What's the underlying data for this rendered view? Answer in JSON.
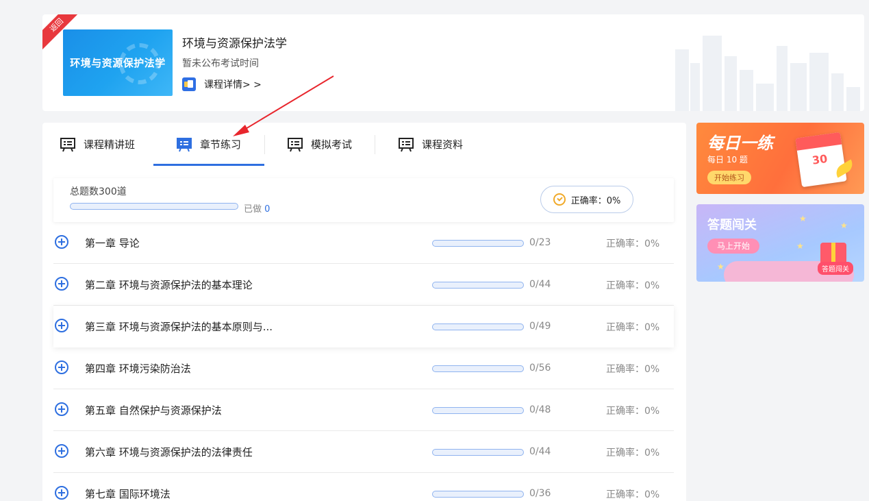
{
  "course": {
    "return_label": "返回",
    "cover_text": "环境与资源保护法学",
    "title": "环境与资源保护法学",
    "exam_time": "暂未公布考试时间",
    "detail_link": "课程详情> >"
  },
  "tabs": [
    {
      "label": "课程精讲班",
      "icon": "presentation-icon",
      "active": false
    },
    {
      "label": "章节练习",
      "icon": "presentation-icon",
      "active": true
    },
    {
      "label": "模拟考试",
      "icon": "presentation-icon",
      "active": false
    },
    {
      "label": "课程资料",
      "icon": "presentation-icon",
      "active": false
    }
  ],
  "summary": {
    "total": "总题数300道",
    "done_label": "已做",
    "done_count": "0",
    "accuracy": "正确率：0%"
  },
  "chapters": [
    {
      "title": "第一章 导论",
      "count": "0/23",
      "accuracy": "正确率：0%"
    },
    {
      "title": "第二章 环境与资源保护法的基本理论",
      "count": "0/44",
      "accuracy": "正确率：0%"
    },
    {
      "title": "第三章 环境与资源保护法的基本原则与...",
      "count": "0/49",
      "accuracy": "正确率：0%"
    },
    {
      "title": "第四章 环境污染防治法",
      "count": "0/56",
      "accuracy": "正确率：0%"
    },
    {
      "title": "第五章 自然保护与资源保护法",
      "count": "0/48",
      "accuracy": "正确率：0%"
    },
    {
      "title": "第六章 环境与资源保护法的法律责任",
      "count": "0/44",
      "accuracy": "正确率：0%"
    },
    {
      "title": "第七章 国际环境法",
      "count": "0/36",
      "accuracy": "正确率：0%"
    }
  ],
  "banners": {
    "daily": {
      "title": "每日一练",
      "sub": "每日 10 题",
      "button": "开始练习",
      "calendar_num": "30",
      "calendar_top": "CCCCC"
    },
    "quiz": {
      "title": "答题闯关",
      "button": "马上开始",
      "badge": "答题闯关"
    }
  },
  "colors": {
    "accent": "#2e6fe0",
    "arrow": "#e8262d",
    "return_tag": "#e8383d"
  }
}
